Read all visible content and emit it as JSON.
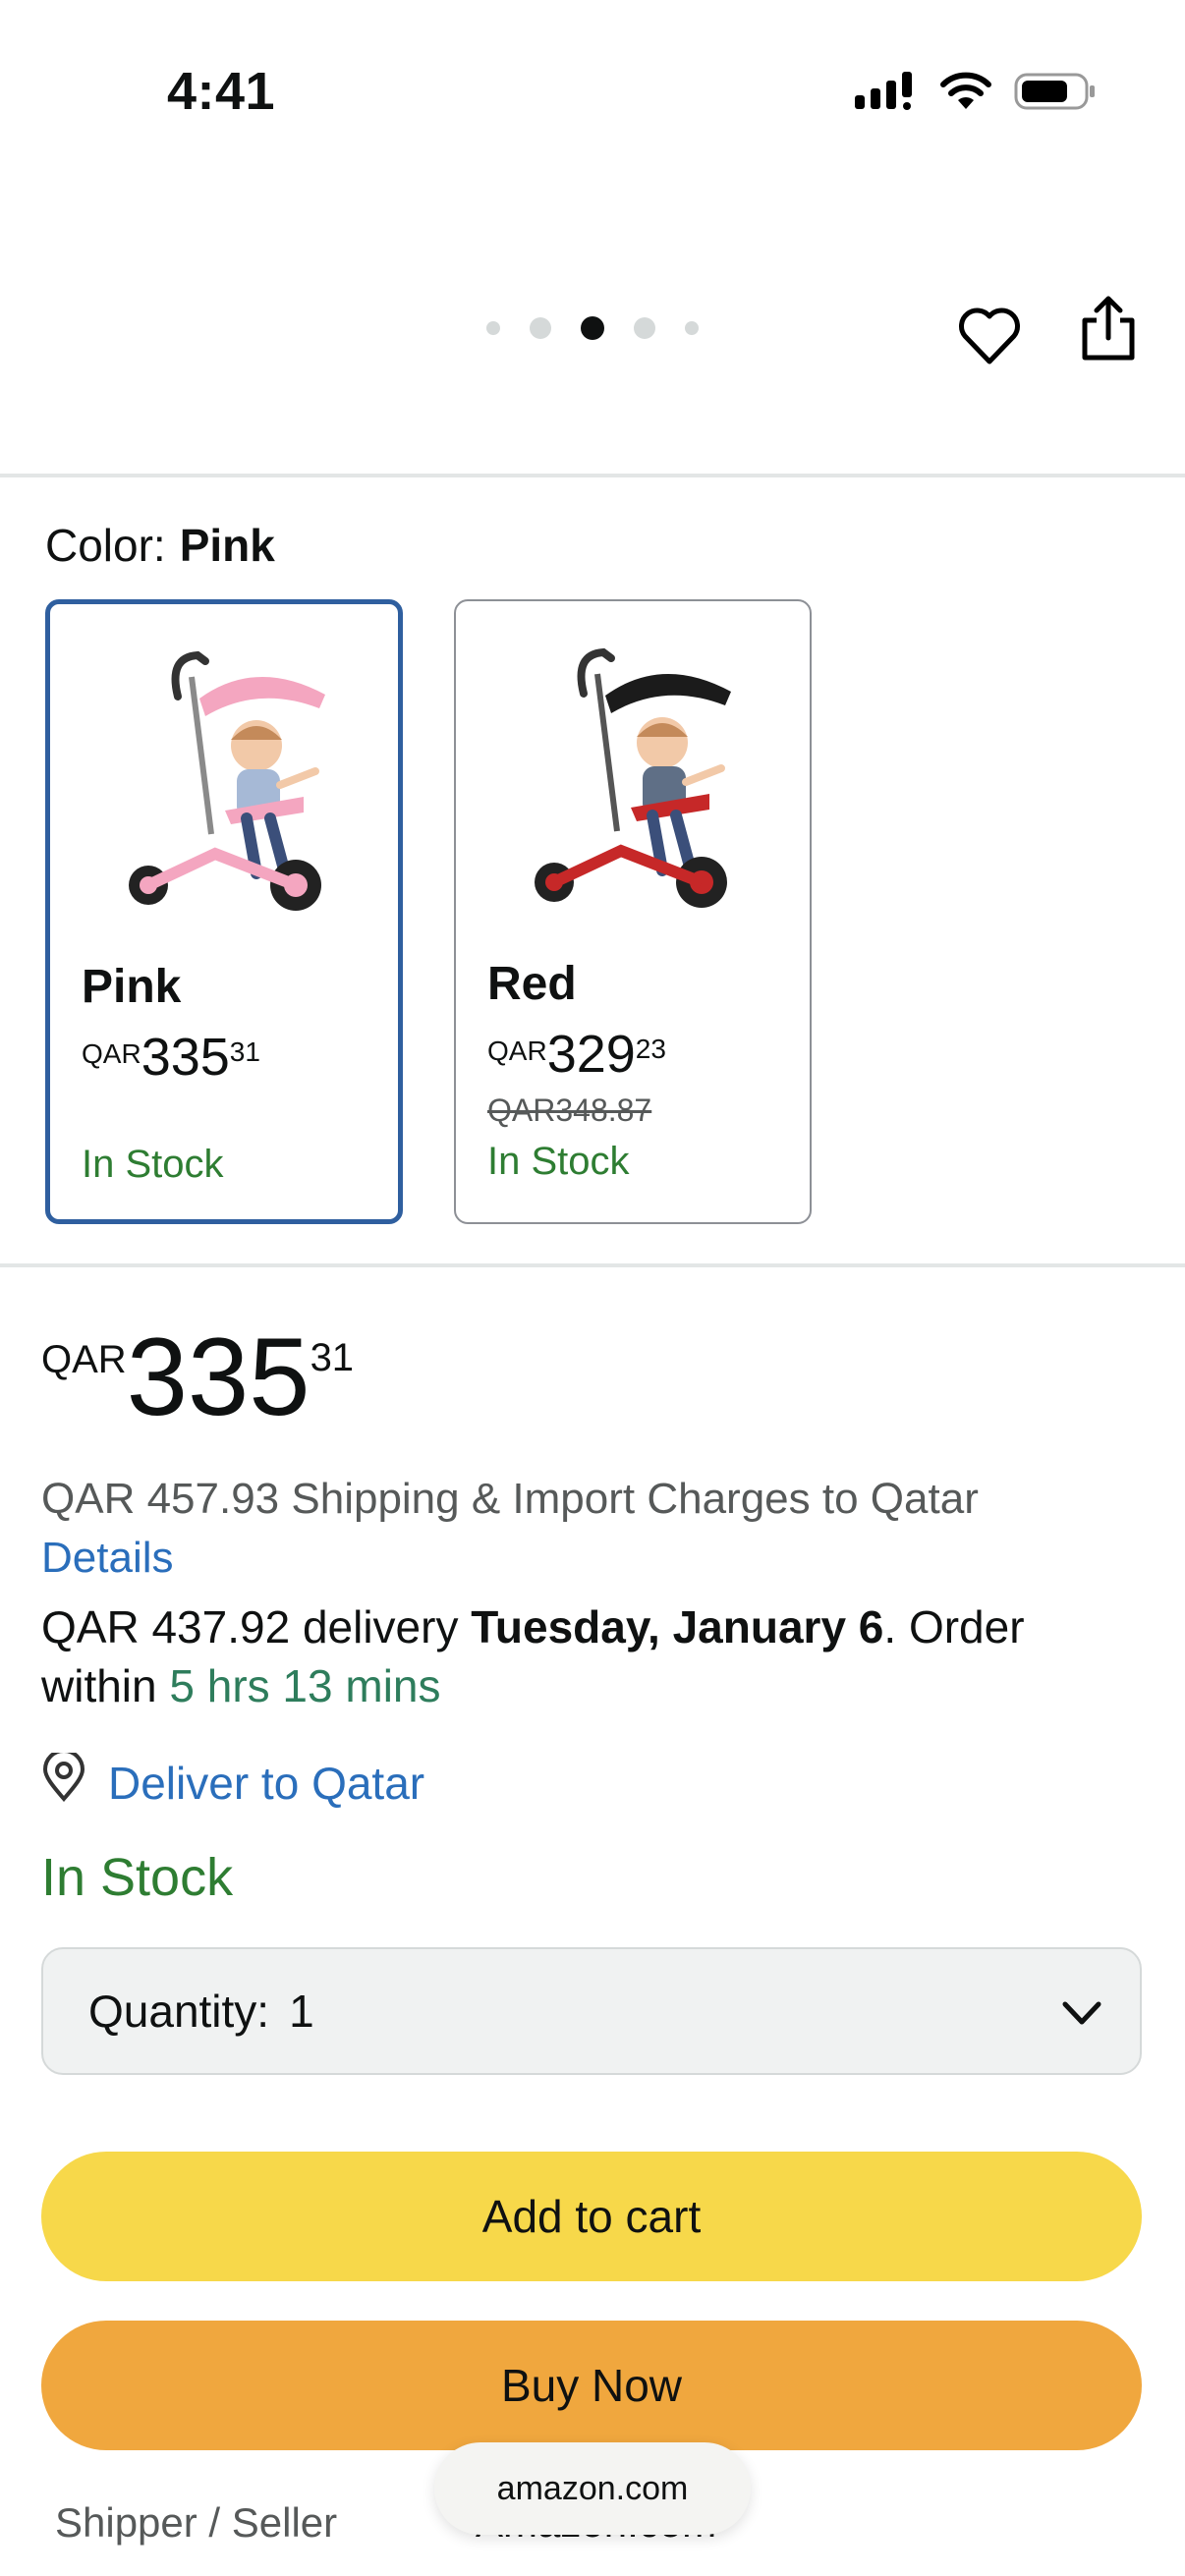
{
  "status_bar": {
    "time": "4:41",
    "signal_icon": "signal-icon",
    "wifi_icon": "wifi-icon",
    "battery_icon": "battery-icon"
  },
  "gallery": {
    "dot_count": 5,
    "active_dot": 3,
    "heart_icon": "heart-icon",
    "share_icon": "share-icon"
  },
  "color": {
    "label": "Color:",
    "value": "Pink"
  },
  "swatches": [
    {
      "name": "Pink",
      "currency": "QAR",
      "price_whole": "335",
      "price_frac": "31",
      "stock": "In Stock",
      "frame_color": "#f4a6c0"
    },
    {
      "name": "Red",
      "currency": "QAR",
      "price_whole": "329",
      "price_frac": "23",
      "was_price": "QAR348.87",
      "stock": "In Stock",
      "frame_color": "#c62828"
    }
  ],
  "price": {
    "currency": "QAR",
    "whole": "335",
    "frac": "31"
  },
  "shipping": {
    "text": "QAR 457.93 Shipping & Import Charges to Qatar",
    "details_link": "Details"
  },
  "delivery": {
    "prefix": "QAR 437.92 delivery ",
    "date": "Tuesday, January 6",
    "middle": ". Order within ",
    "countdown": "5 hrs 13 mins"
  },
  "deliver_to": {
    "icon": "location-pin-icon",
    "label": "Deliver to Qatar"
  },
  "availability": "In Stock",
  "quantity": {
    "label": "Quantity:",
    "value": "1"
  },
  "buttons": {
    "add_to_cart": "Add to cart",
    "buy_now": "Buy Now"
  },
  "footer": {
    "shipper_label": "Shipper / Seller",
    "seller_value": "Amazon.com",
    "url": "amazon.com"
  },
  "colors": {
    "accent_blue": "#2f5f9f",
    "link_blue": "#2a6ebb",
    "stock_green": "#2e7d32",
    "cart_yellow": "#f7d84a",
    "buy_orange": "#f0a73e"
  }
}
